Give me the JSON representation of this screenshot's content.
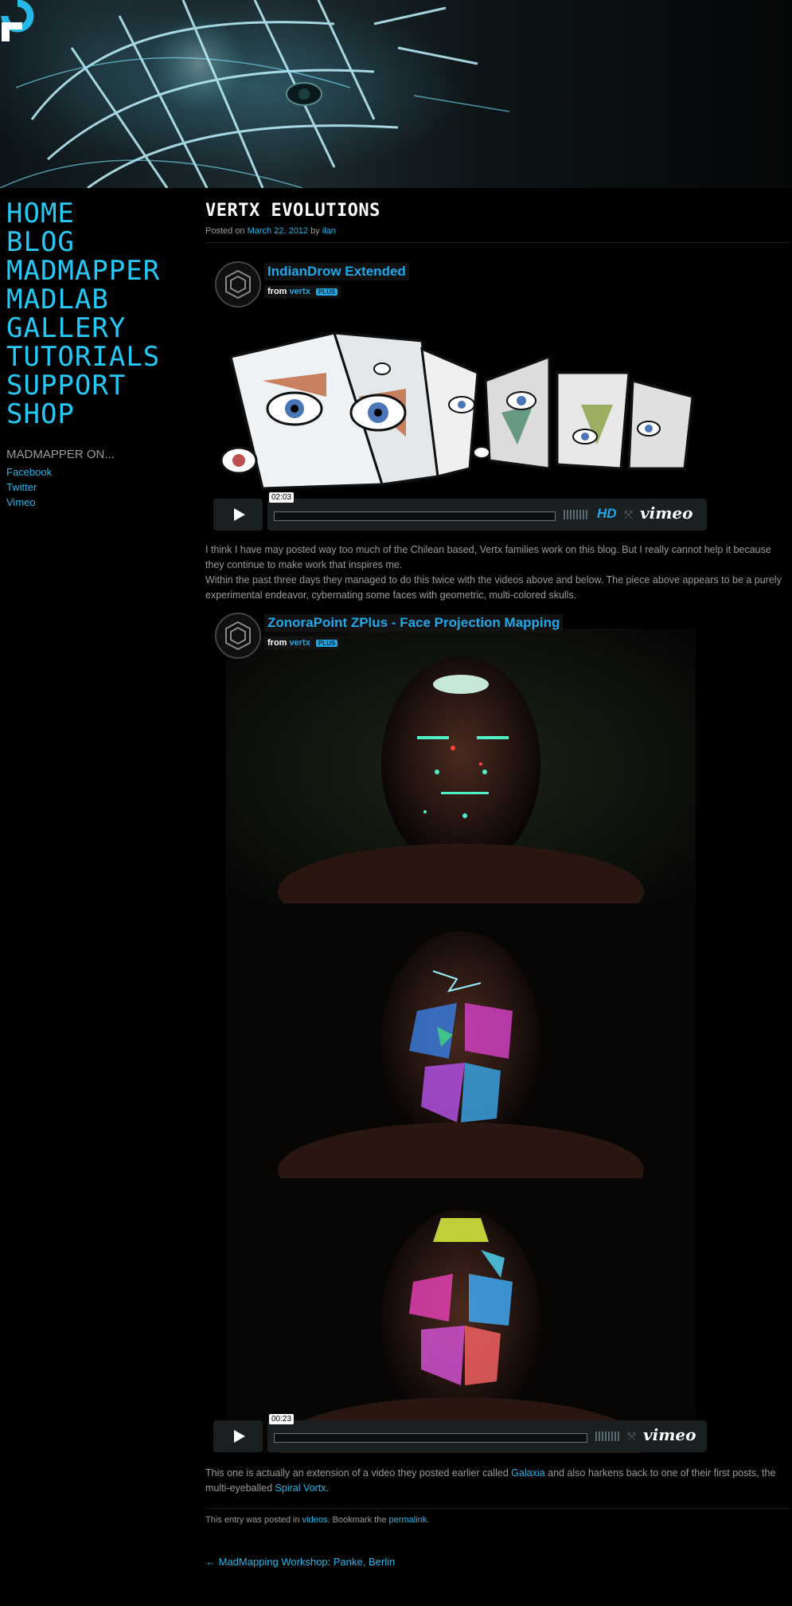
{
  "nav": {
    "items": [
      "HOME",
      "BLOG",
      "MADMAPPER",
      "MADLAB",
      "GALLERY",
      "TUTORIALS",
      "SUPPORT",
      "SHOP"
    ]
  },
  "social": {
    "title": "MADMAPPER ON...",
    "links": [
      "Facebook",
      "Twitter",
      "Vimeo"
    ]
  },
  "post": {
    "title": "VERTX EVOLUTIONS",
    "posted_on": "Posted on",
    "date": "March 22, 2012",
    "by": "by",
    "author": "ilan"
  },
  "video1": {
    "title": "IndianDrow Extended",
    "from": "from",
    "author": "vertx",
    "badge": "PLUS",
    "timecode": "02:03",
    "hd": "HD",
    "brand": "vimeo"
  },
  "body": {
    "p1": "I think I have may posted way too much of the Chilean based, Vertx families work on this blog. But I really cannot help it because they continue to make work that inspires me.",
    "p2": "Within the past three days they managed to do this twice with the videos above and below. The piece above appears to be a purely experimental endeavor, cybernating some faces with geometric, multi-colored skulls.",
    "p3_a": "This one is actually an extension of a video they posted earlier called ",
    "p3_link1": "Galaxia",
    "p3_b": " and also harkens back to one of their first posts, the multi-eyeballed ",
    "p3_link2": "Spiral Vortx",
    "p3_c": "."
  },
  "video2": {
    "title": "ZonoraPoint ZPlus - Face Projection Mapping",
    "from": "from",
    "author": "vertx",
    "badge": "PLUS",
    "timecode": "00:23",
    "brand": "vimeo"
  },
  "footer": {
    "entry_text": "This entry was posted in ",
    "category": "videos",
    "bookmark_text": ". Bookmark the ",
    "permalink": "permalink",
    "end": ".",
    "prev_post": "← MadMapping Workshop: Panke, Berlin"
  },
  "icons": {
    "logo": "madmapper-logo-icon",
    "avatar": "vertx-cube-icon",
    "play": "play-icon",
    "fullscreen": "fullscreen-icon"
  },
  "colors": {
    "accent": "#26c8f5",
    "link": "#26b5e8",
    "background": "#000000"
  }
}
